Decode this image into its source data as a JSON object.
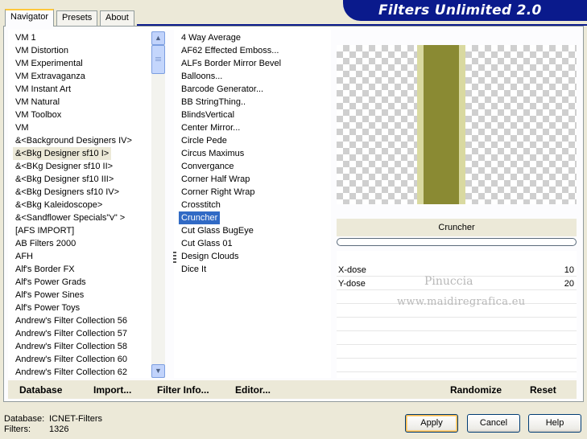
{
  "header": {
    "title": "Filters Unlimited 2.0"
  },
  "tabs": [
    {
      "label": "Navigator",
      "active": true
    },
    {
      "label": "Presets",
      "active": false
    },
    {
      "label": "About",
      "active": false
    }
  ],
  "categories": [
    "VM 1",
    "VM Distortion",
    "VM Experimental",
    "VM Extravaganza",
    "VM Instant Art",
    "VM Natural",
    "VM Toolbox",
    "VM",
    "&<Background Designers IV>",
    "&<Bkg Designer sf10 I>",
    "&<BKg Designer sf10 II>",
    "&<Bkg Designer sf10 III>",
    "&<Bkg Designers sf10 IV>",
    "&<Bkg Kaleidoscope>",
    "&<Sandflower Specials\"v\" >",
    "[AFS IMPORT]",
    "AB Filters 2000",
    "AFH",
    "Alf's Border FX",
    "Alf's Power Grads",
    "Alf's Power Sines",
    "Alf's Power Toys",
    "Andrew's Filter Collection 56",
    "Andrew's Filter Collection 57",
    "Andrew's Filter Collection 58",
    "Andrew's Filter Collection 60",
    "Andrew's Filter Collection 62"
  ],
  "selected_category_index": 9,
  "filters": [
    "4 Way Average",
    "AF62 Effected Emboss...",
    "ALFs Border Mirror Bevel",
    "Balloons...",
    "Barcode Generator...",
    "BB StringThing..",
    "BlindsVertical",
    "Center Mirror...",
    "Circle Pede",
    "Circus Maximus",
    "Convergance",
    "Corner Half Wrap",
    "Corner Right Wrap",
    "Crosstitch",
    "Cruncher",
    "Cut Glass  BugEye",
    "Cut Glass 01",
    "Design Clouds",
    "Dice It"
  ],
  "selected_filter_index": 14,
  "preview": {
    "filter_name": "Cruncher",
    "stripe_color": "#8a8a33",
    "stripe_edge_color": "#d9d9a0"
  },
  "params": [
    {
      "label": "X-dose",
      "value": "10"
    },
    {
      "label": "Y-dose",
      "value": "20"
    }
  ],
  "watermark": {
    "line1": "Pinuccia",
    "line2": "www.maidiregrafica.eu"
  },
  "bottom_buttons": {
    "database": "Database",
    "import": "Import...",
    "filter_info": "Filter Info...",
    "editor": "Editor...",
    "randomize": "Randomize",
    "reset": "Reset"
  },
  "status": {
    "database_label": "Database:",
    "database_value": "ICNET-Filters",
    "filters_label": "Filters:",
    "filters_value": "1326"
  },
  "dialog_buttons": {
    "apply": "Apply",
    "cancel": "Cancel",
    "help": "Help"
  },
  "icons": {
    "scroll_up": "▲",
    "scroll_down": "▼"
  }
}
